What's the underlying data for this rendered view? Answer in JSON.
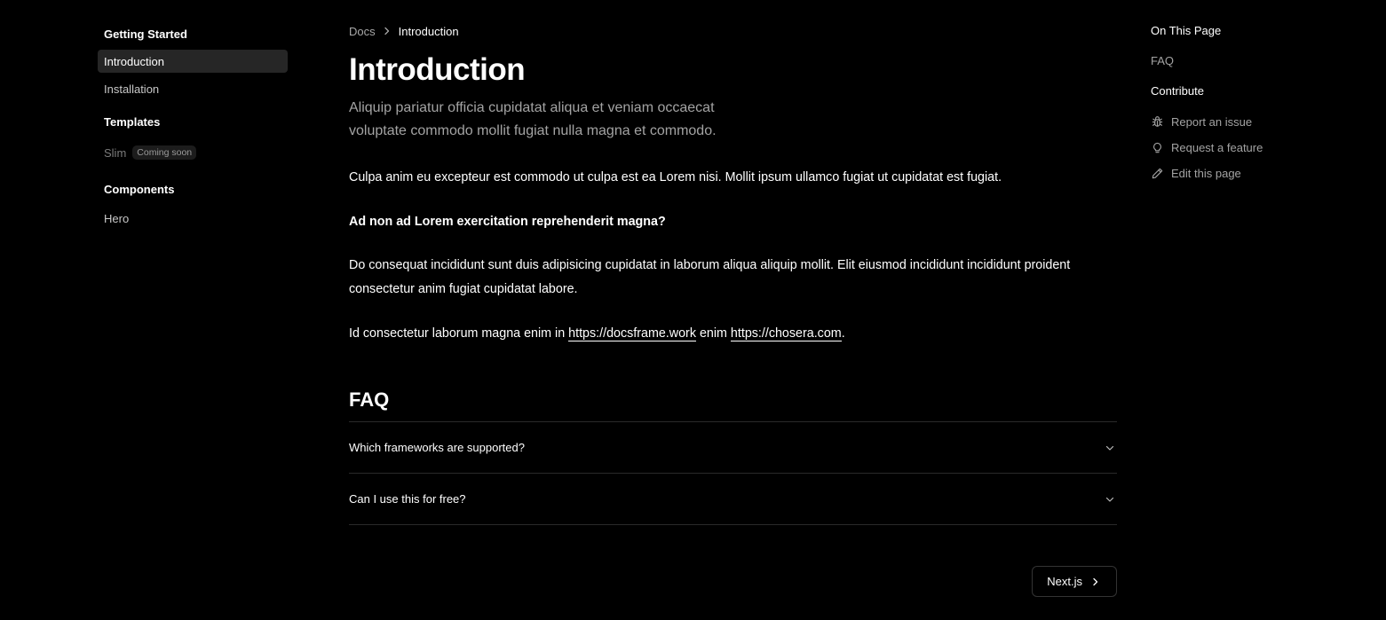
{
  "sidebar": {
    "groups": [
      {
        "title": "Getting Started",
        "items": [
          {
            "label": "Introduction"
          },
          {
            "label": "Installation"
          }
        ]
      },
      {
        "title": "Templates",
        "items": [
          {
            "label": "Slim",
            "badge": "Coming soon"
          }
        ]
      },
      {
        "title": "Components",
        "items": [
          {
            "label": "Hero"
          }
        ]
      }
    ]
  },
  "breadcrumb": {
    "root": "Docs",
    "current": "Introduction"
  },
  "main": {
    "title": "Introduction",
    "subtitle": "Aliquip pariatur officia cupidatat aliqua et veniam occaecat voluptate commodo mollit fugiat nulla magna et commodo.",
    "paragraph1": "Culpa anim eu excepteur est commodo ut culpa est ea Lorem nisi. Mollit ipsum ullamco fugiat ut cupidatat est fugiat.",
    "question": "Ad non ad Lorem exercitation reprehenderit magna?",
    "paragraph2": "Do consequat incididunt sunt duis adipisicing cupidatat in laborum aliqua aliquip mollit. Elit eiusmod incididunt incididunt proident consectetur anim fugiat cupidatat labore.",
    "paragraph3": {
      "prefix": "Id consectetur laborum magna enim in ",
      "link1": "https://docsframe.work",
      "middle": " enim ",
      "link2": "https://chosera.com",
      "suffix": "."
    },
    "faq": {
      "title": "FAQ",
      "items": [
        {
          "question": "Which frameworks are supported?"
        },
        {
          "question": "Can I use this for free?"
        }
      ]
    },
    "next_button": {
      "label": "Next.js"
    }
  },
  "toc": {
    "title": "On This Page",
    "links": [
      {
        "label": "FAQ"
      }
    ],
    "contribute_title": "Contribute",
    "actions": [
      {
        "label": "Report an issue",
        "icon": "bug-icon"
      },
      {
        "label": "Request a feature",
        "icon": "lightbulb-icon"
      },
      {
        "label": "Edit this page",
        "icon": "pencil-icon"
      }
    ]
  },
  "colors": {
    "background": "#000000",
    "text": "#ffffff",
    "muted_text": "#a3a3a3",
    "active_item_bg": "#262626",
    "border": "#2a2a2a"
  }
}
